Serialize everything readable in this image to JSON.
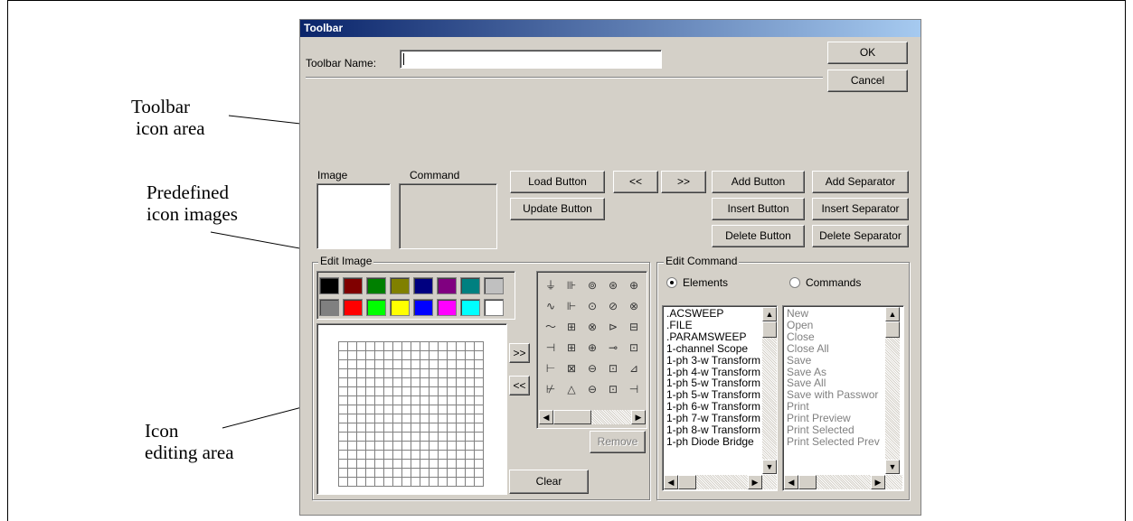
{
  "annotations": {
    "toolbar_icon_area": "Toolbar\n icon area",
    "predefined_icon_images": "Predefined\nicon images",
    "icon_editing_area": "Icon\nediting area"
  },
  "dialog": {
    "title": "Toolbar",
    "toolbar_name_label": "Toolbar Name:",
    "toolbar_name_value": "",
    "ok_label": "OK",
    "cancel_label": "Cancel",
    "image_label": "Image",
    "command_label": "Command",
    "load_button": "Load Button",
    "update_button": "Update Button",
    "prev_label": "<<",
    "next_label": ">>",
    "add_button": "Add Button",
    "insert_button": "Insert Button",
    "delete_button": "Delete Button",
    "add_separator": "Add Separator",
    "insert_separator": "Insert Separator",
    "delete_separator": "Delete Separator",
    "edit_image_label": "Edit Image",
    "move_right_label": ">>",
    "move_left_label": "<<",
    "remove_label": "Remove",
    "clear_label": "Clear",
    "edit_command_label": "Edit Command",
    "radio_elements": "Elements",
    "radio_commands": "Commands",
    "elements_list": [
      ".ACSWEEP",
      ".FILE",
      ".PARAMSWEEP",
      "1-channel Scope",
      "1-ph 3-w Transform",
      "1-ph 4-w Transform",
      "1-ph 5-w Transform",
      "1-ph 5-w Transform",
      "1-ph 6-w Transform",
      "1-ph 7-w Transform",
      "1-ph 8-w Transform",
      "1-ph Diode Bridge"
    ],
    "commands_list": [
      "New",
      "Open",
      "Close",
      "Close All",
      "Save",
      "Save As",
      "Save All",
      "Save with Passwor",
      "Print",
      "Print Preview",
      "Print Selected",
      "Print Selected Prev"
    ],
    "colors_row1": [
      "#000000",
      "#800000",
      "#008000",
      "#808000",
      "#000080",
      "#800080",
      "#008080",
      "#c0c0c0"
    ],
    "colors_row2": [
      "#808080",
      "#ff0000",
      "#00ff00",
      "#ffff00",
      "#0000ff",
      "#ff00ff",
      "#00ffff",
      "#ffffff"
    ],
    "icon_glyphs": [
      [
        "⏚",
        "⊪",
        "⊚",
        "⊛",
        "⊕"
      ],
      [
        "∿",
        "⊩",
        "⊙",
        "⊘",
        "⊗"
      ],
      [
        "〜",
        "⊞",
        "⊗",
        "⊳",
        "⊟"
      ],
      [
        "⊣",
        "⊞",
        "⊕",
        "⊸",
        "⊡"
      ],
      [
        "⊢",
        "⊠",
        "⊖",
        "⊡",
        "⊿"
      ],
      [
        "⊬",
        "△",
        "⊖",
        "⊡",
        "⊣"
      ]
    ]
  }
}
